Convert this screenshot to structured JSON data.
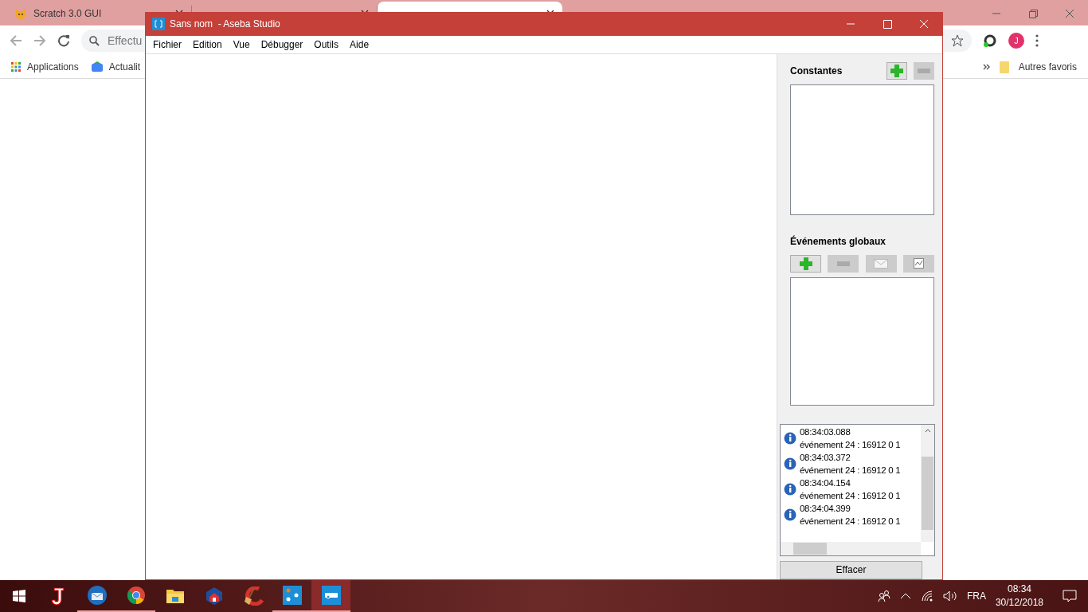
{
  "browser": {
    "tabs": [
      {
        "title": "Scratch 3.0 GUI",
        "selected": false
      },
      {
        "selected": false
      },
      {
        "selected": true
      }
    ],
    "address": {
      "placeholder": "Effectu"
    },
    "bookmarks": [
      "Applications",
      "Actualit"
    ],
    "other_bookmarks": "Autres favoris",
    "avatar": "J"
  },
  "window": {
    "title": "Sans nom  - Aseba Studio",
    "menu": [
      "Fichier",
      "Edition",
      "Vue",
      "Débugger",
      "Outils",
      "Aide"
    ],
    "constants": {
      "title": "Constantes"
    },
    "events": {
      "title": "Événements globaux"
    },
    "log": [
      {
        "time": "08:34:03.088",
        "message": "événement 24 : 16912 0 1"
      },
      {
        "time": "08:34:03.372",
        "message": "événement 24 : 16912 0 1"
      },
      {
        "time": "08:34:04.154",
        "message": "événement 24 : 16912 0 1"
      },
      {
        "time": "08:34:04.399",
        "message": "événement 24 : 16912 0 1"
      }
    ],
    "clear_button": "Effacer"
  },
  "taskbar": {
    "apps": [
      {
        "kind": "jlogo",
        "running": false,
        "selected": false
      },
      {
        "kind": "mail",
        "running": true,
        "selected": false
      },
      {
        "kind": "chrome",
        "running": true,
        "selected": false
      },
      {
        "kind": "folder",
        "running": false,
        "selected": false
      },
      {
        "kind": "house",
        "running": false,
        "selected": false
      },
      {
        "kind": "cleaner",
        "running": false,
        "selected": false
      },
      {
        "kind": "dots",
        "running": true,
        "selected": false
      },
      {
        "kind": "aseba",
        "running": true,
        "selected": true
      }
    ],
    "language": "FRA",
    "time": "08:34",
    "date": "30/12/2018"
  }
}
